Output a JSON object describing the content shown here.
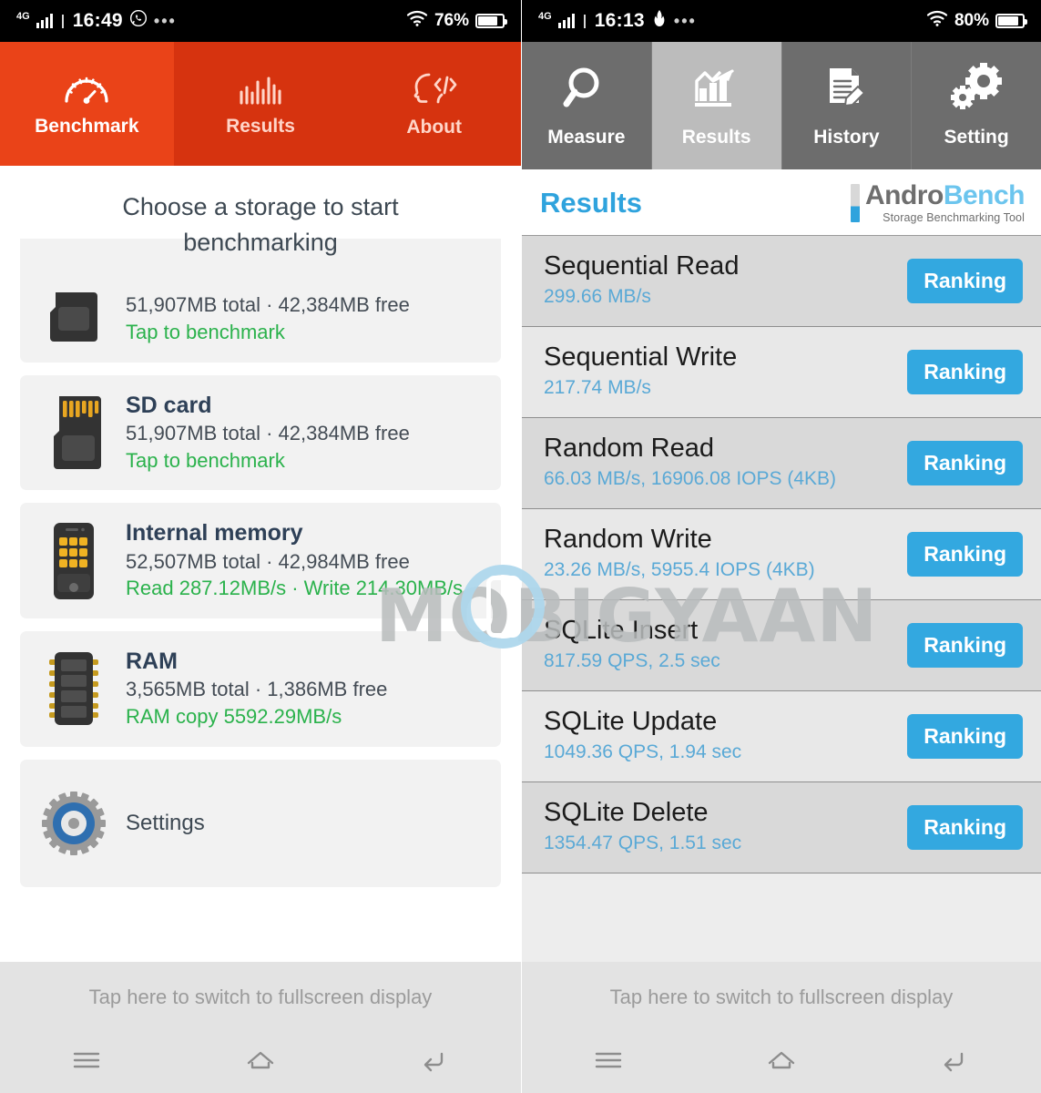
{
  "left": {
    "status_bar": {
      "network": "4G",
      "time": "16:49",
      "app_icon": "whatsapp-icon",
      "overflow": "•••",
      "wifi_icon": "wifi-icon",
      "battery_percent": "76%",
      "battery_level": 76
    },
    "tabs": [
      {
        "label": "Benchmark",
        "icon": "speedometer-icon",
        "active": true
      },
      {
        "label": "Results",
        "icon": "bar-chart-icon",
        "active": false
      },
      {
        "label": "About",
        "icon": "head-code-icon",
        "active": false
      }
    ],
    "heading": "Choose a storage to start benchmarking",
    "storage_items": [
      {
        "name": "",
        "capacity": "51,907MB total · 42,384MB free",
        "action": "Tap to benchmark",
        "icon": "sd-card-icon",
        "clipped": true
      },
      {
        "name": "SD card",
        "capacity": "51,907MB total · 42,384MB free",
        "action": "Tap to benchmark",
        "icon": "sd-card-icon",
        "clipped": false
      },
      {
        "name": "Internal memory",
        "capacity": "52,507MB total · 42,984MB free",
        "action": "Read 287.12MB/s · Write 214.30MB/s",
        "icon": "phone-icon",
        "clipped": false
      },
      {
        "name": "RAM",
        "capacity": "3,565MB total · 1,386MB free",
        "action": "RAM copy 5592.29MB/s",
        "icon": "ram-chip-icon",
        "clipped": false
      }
    ],
    "settings": {
      "label": "Settings",
      "icon": "gear-icon"
    },
    "fullscreen_hint": "Tap here to switch to fullscreen display",
    "nav": [
      {
        "icon": "menu-icon"
      },
      {
        "icon": "home-icon"
      },
      {
        "icon": "back-icon"
      }
    ]
  },
  "right": {
    "status_bar": {
      "network": "4G",
      "time": "16:13",
      "app_icon": "tulip-icon",
      "overflow": "•••",
      "wifi_icon": "wifi-icon",
      "battery_percent": "80%",
      "battery_level": 80
    },
    "tabs": [
      {
        "label": "Measure",
        "icon": "magnifier-icon",
        "active": false
      },
      {
        "label": "Results",
        "icon": "growth-chart-icon",
        "active": true
      },
      {
        "label": "History",
        "icon": "document-pencil-icon",
        "active": false
      },
      {
        "label": "Setting",
        "icon": "gears-icon",
        "active": false
      }
    ],
    "section_title": "Results",
    "logo": {
      "part_a": "Andro",
      "part_b": "Bench",
      "tagline": "Storage Benchmarking Tool"
    },
    "ranking_label": "Ranking",
    "results": [
      {
        "name": "Sequential Read",
        "value": "299.66 MB/s"
      },
      {
        "name": "Sequential Write",
        "value": "217.74 MB/s"
      },
      {
        "name": "Random Read",
        "value": "66.03 MB/s, 16906.08 IOPS (4KB)"
      },
      {
        "name": "Random Write",
        "value": "23.26 MB/s, 5955.4 IOPS (4KB)"
      },
      {
        "name": "SQLite Insert",
        "value": "817.59 QPS, 2.5 sec"
      },
      {
        "name": "SQLite Update",
        "value": "1049.36 QPS, 1.94 sec"
      },
      {
        "name": "SQLite Delete",
        "value": "1354.47 QPS, 1.51 sec"
      }
    ],
    "fullscreen_hint": "Tap here to switch to fullscreen display",
    "nav": [
      {
        "icon": "menu-icon"
      },
      {
        "icon": "home-icon"
      },
      {
        "icon": "back-icon"
      }
    ]
  },
  "watermark": {
    "text": "MOBIGYAAN"
  },
  "colors": {
    "red_active": "#ea4318",
    "red_bar": "#d6330f",
    "grey_tab": "#6d6d6d",
    "grey_tab_active": "#bcbcbc",
    "accent_blue": "#33a8e0",
    "green": "#2bb24c"
  }
}
